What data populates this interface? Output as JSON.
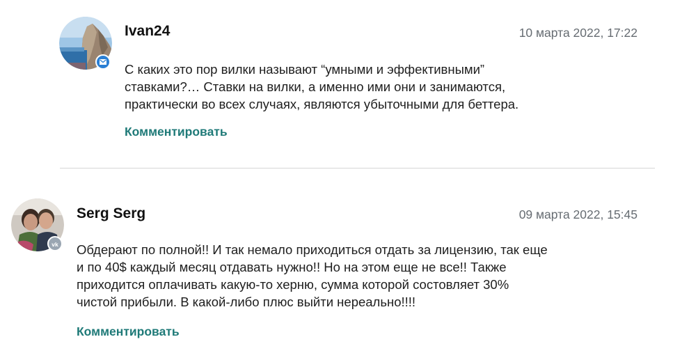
{
  "comments": [
    {
      "author": "Ivan24",
      "date": "10 марта 2022, 17:22",
      "text": "С каких это пор вилки называют “умными и эффективными”\nставками?… Ставки на вилки, а именно ими они и занимаются,\nпрактически во всех случаях, являются убыточными для беттера.",
      "reply_label": "Комментировать",
      "badge_icon": "mail-icon",
      "badge_color": "#2a7fd4"
    },
    {
      "author": "Serg Serg",
      "date": "09 марта 2022, 15:45",
      "text": "Обдерают по полной!! И так немало приходиться отдать за лицензию, так еще\nи по 40$ каждый месяц отдавать нужно!! Но на этом еще не все!! Также\nприходится оплачивать какую-то херню, сумма которой состовляет 30%\nчистой прибыли. В какой-либо плюс выйти нереально!!!!",
      "reply_label": "Комментировать",
      "badge_icon": "vk-icon",
      "badge_color": "#9aa6b2"
    }
  ],
  "colors": {
    "reply_link": "#1f7a78",
    "date_text": "#666c72",
    "divider": "#d6d6d6"
  }
}
